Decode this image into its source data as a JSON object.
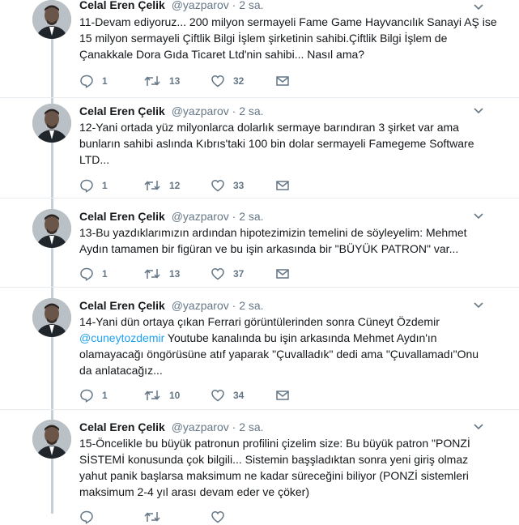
{
  "author": {
    "name": "Celal Eren Çelik",
    "handle": "@yazparov",
    "separator": "·"
  },
  "tweets": [
    {
      "time": "2 sa.",
      "text": "11-Devam ediyoruz... 200 milyon sermayeli Fame Game Hayvancılık Sanayi AŞ ise\n15 milyon sermayeli Çiftlik Bilgi İşlem şirketinin sahibi.Çiftlik Bilgi İşlem de\nÇanakkale Dora Gıda Ticaret Ltd'nin sahibi... Nasıl ama?",
      "replies": "1",
      "retweets": "13",
      "likes": "32"
    },
    {
      "time": "2 sa.",
      "text": "12-Yani ortada yüz milyonlarca dolarlık sermaye barındıran 3 şirket var ama\nbunların sahibi aslında Kıbrıs'taki 100 bin dolar sermayeli Famegeme Software\nLTD...",
      "replies": "1",
      "retweets": "12",
      "likes": "33"
    },
    {
      "time": "2 sa.",
      "text": "13-Bu yazdıklarımızın ardından hipotezimizin temelini de söyleyelim: Mehmet\nAydın tamamen bir figüran ve bu işin arkasında bir \"BÜYÜK PATRON\" var...",
      "replies": "1",
      "retweets": "13",
      "likes": "37"
    },
    {
      "time": "2 sa.",
      "text_before": "14-Yani dün ortaya çıkan Ferrari görüntülerinden sonra Cüneyt Özdemir\n",
      "mention": "@cuneytozdemir",
      "text_after": " Youtube kanalında bu işin arkasında Mehmet Aydın'ın\nolamayacağı öngörüsüne atıf  yaparak \"Çuvalladık\" dedi ama \"Çuvallamadı\"Onu\nda anlatacağız...",
      "replies": "1",
      "retweets": "10",
      "likes": "34"
    },
    {
      "time": "2 sa.",
      "text": "15-Öncelikle bu büyük patronun profilini çizelim size: Bu büyük patron \"PONZİ\nSİSTEMİ konusunda çok bilgili... Sistemin başşladıktan sonra yeni giriş olmaz\nyahut panik başlarsa maksimum ne kadar süreceğini biliyor (PONZİ sistemleri\nmaksimum 2-4 yıl arası devam eder ve çöker)",
      "replies": "",
      "retweets": "",
      "likes": ""
    }
  ],
  "icons": {
    "reply": "reply-icon",
    "retweet": "retweet-icon",
    "like": "heart-icon",
    "dm": "envelope-icon",
    "more": "chevron-down-icon"
  },
  "colors": {
    "text": "#14171a",
    "secondary": "#657786",
    "link": "#1da1f2",
    "thread_line": "#c4cfd6",
    "divider": "#e6ecf0"
  }
}
